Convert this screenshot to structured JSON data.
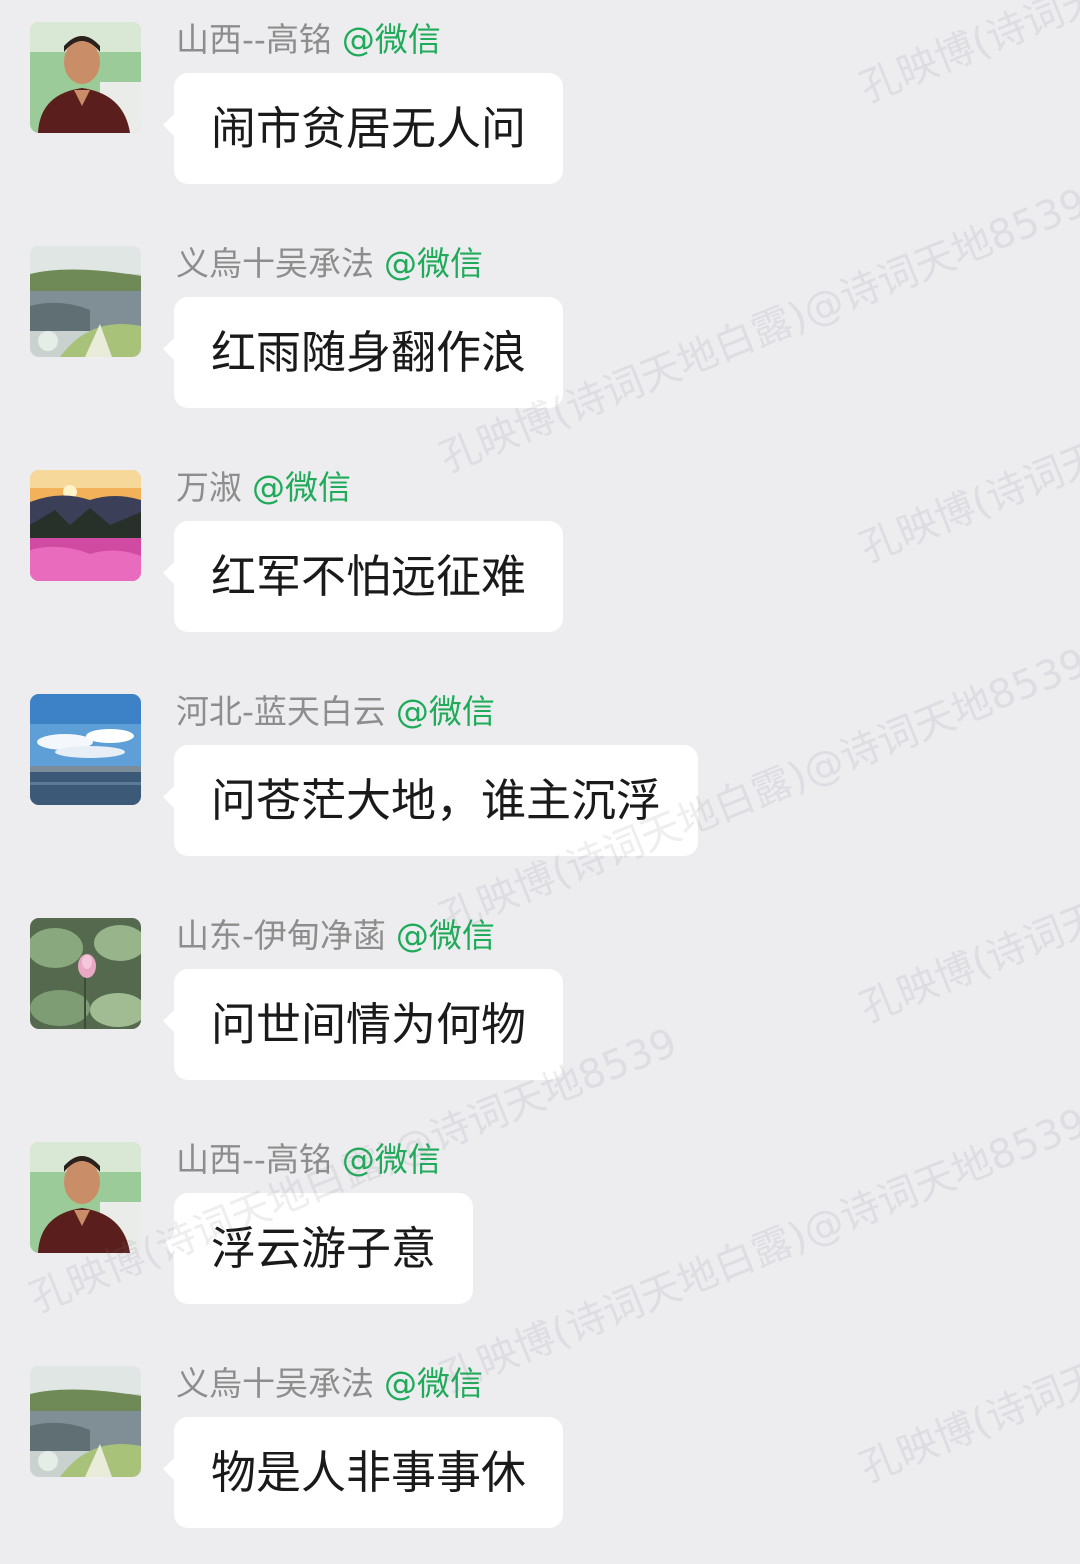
{
  "messages": [
    {
      "sender": "山西--高铭",
      "tag": "@微信",
      "text": "闹市贫居无人问",
      "avatar": "person-avatar"
    },
    {
      "sender": "义烏十吴承法",
      "tag": "@微信",
      "text": "红雨随身翻作浪",
      "avatar": "lake-avatar"
    },
    {
      "sender": "万淑",
      "tag": "@微信",
      "text": "红军不怕远征难",
      "avatar": "sunset-flowers-avatar"
    },
    {
      "sender": "河北-蓝天白云",
      "tag": "@微信",
      "text": "问苍茫大地，谁主沉浮",
      "avatar": "sea-sky-avatar"
    },
    {
      "sender": "山东-伊甸净菡",
      "tag": "@微信",
      "text": "问世间情为何物",
      "avatar": "lotus-avatar"
    },
    {
      "sender": "山西--高铭",
      "tag": "@微信",
      "text": "浮云游子意",
      "avatar": "person-avatar"
    },
    {
      "sender": "义烏十吴承法",
      "tag": "@微信",
      "text": "物是人非事事休",
      "avatar": "lake-avatar"
    }
  ],
  "watermarks": {
    "a": "孔映博(诗词天地白露)@诗词天地8539",
    "b": "孔映博(诗词天地白露)@诗词天地8539",
    "c": "孔映博(诗词天地白露)@诗词天地8539",
    "d": "孔映博(诗词天地白露)@诗词天地8539",
    "e": "孔映博(诗词天地白露)@诗词天地8539",
    "f": "孔映博(诗词天地白露)@诗词天地8539",
    "g": "孔映博(诗词天地白露)@诗词天地8539",
    "h": "孔映博(诗词天地白露)@诗词天地8539"
  }
}
